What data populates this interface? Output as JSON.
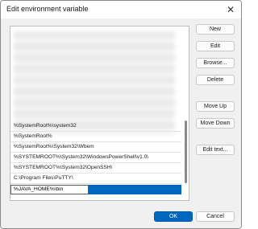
{
  "window": {
    "title": "Edit environment variable"
  },
  "list": {
    "rows": [
      "%SystemRoot%\\system32",
      "%SystemRoot%",
      "%SystemRoot%\\System32\\Wbem",
      "%SYSTEMROOT%\\System32\\WindowsPowerShell\\v1.0\\",
      "%SYSTEMROOT%\\System32\\OpenSSH\\",
      "C:\\Program Files\\PuTTY\\"
    ],
    "editing_value": "%JAVA_HOME%\\bin"
  },
  "buttons": {
    "new": "New",
    "edit": "Edit",
    "browse": "Browse...",
    "delete": "Delete",
    "move_up": "Move Up",
    "move_down": "Move Down",
    "edit_text": "Edit text...",
    "ok": "OK",
    "cancel": "Cancel"
  },
  "colors": {
    "accent": "#0067c0",
    "window_bg": "#f0f0f0"
  },
  "icons": {
    "close": "close-icon"
  }
}
